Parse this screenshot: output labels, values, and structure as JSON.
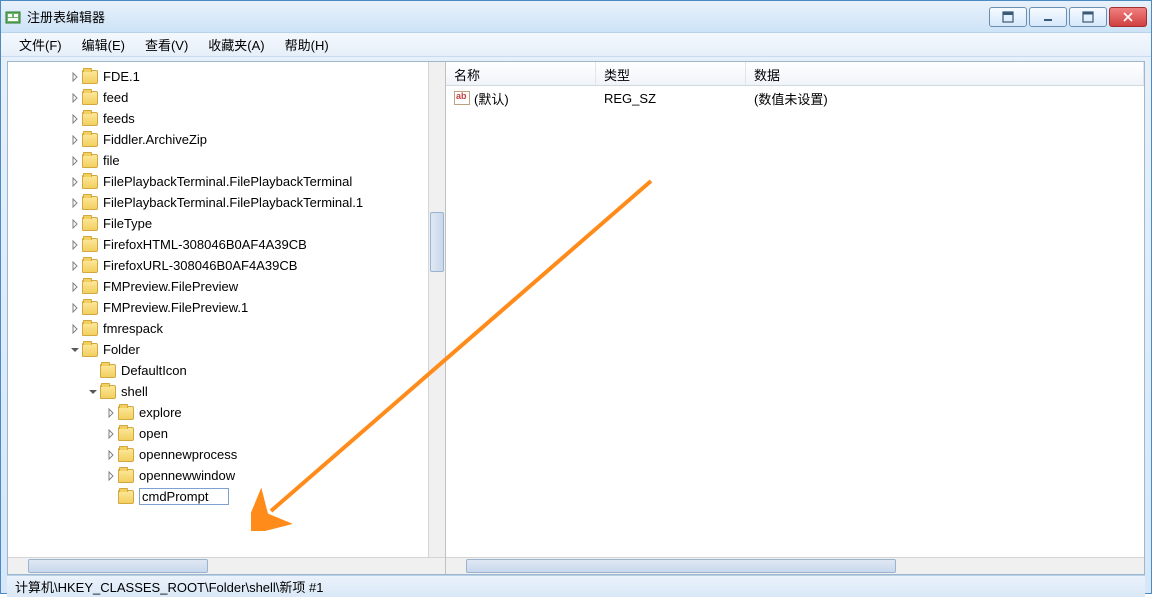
{
  "window": {
    "title": "注册表编辑器"
  },
  "menu": {
    "file": "文件(F)",
    "edit": "编辑(E)",
    "view": "查看(V)",
    "favorites": "收藏夹(A)",
    "help": "帮助(H)"
  },
  "tree": {
    "nodes": [
      {
        "indent": 3,
        "expandable": true,
        "expanded": false,
        "label": "FDE.1"
      },
      {
        "indent": 3,
        "expandable": true,
        "expanded": false,
        "label": "feed"
      },
      {
        "indent": 3,
        "expandable": true,
        "expanded": false,
        "label": "feeds"
      },
      {
        "indent": 3,
        "expandable": true,
        "expanded": false,
        "label": "Fiddler.ArchiveZip"
      },
      {
        "indent": 3,
        "expandable": true,
        "expanded": false,
        "label": "file"
      },
      {
        "indent": 3,
        "expandable": true,
        "expanded": false,
        "label": "FilePlaybackTerminal.FilePlaybackTerminal"
      },
      {
        "indent": 3,
        "expandable": true,
        "expanded": false,
        "label": "FilePlaybackTerminal.FilePlaybackTerminal.1"
      },
      {
        "indent": 3,
        "expandable": true,
        "expanded": false,
        "label": "FileType"
      },
      {
        "indent": 3,
        "expandable": true,
        "expanded": false,
        "label": "FirefoxHTML-308046B0AF4A39CB"
      },
      {
        "indent": 3,
        "expandable": true,
        "expanded": false,
        "label": "FirefoxURL-308046B0AF4A39CB"
      },
      {
        "indent": 3,
        "expandable": true,
        "expanded": false,
        "label": "FMPreview.FilePreview"
      },
      {
        "indent": 3,
        "expandable": true,
        "expanded": false,
        "label": "FMPreview.FilePreview.1"
      },
      {
        "indent": 3,
        "expandable": true,
        "expanded": false,
        "label": "fmrespack"
      },
      {
        "indent": 3,
        "expandable": true,
        "expanded": true,
        "label": "Folder"
      },
      {
        "indent": 4,
        "expandable": false,
        "expanded": false,
        "label": "DefaultIcon"
      },
      {
        "indent": 4,
        "expandable": true,
        "expanded": true,
        "label": "shell"
      },
      {
        "indent": 5,
        "expandable": true,
        "expanded": false,
        "label": "explore"
      },
      {
        "indent": 5,
        "expandable": true,
        "expanded": false,
        "label": "open"
      },
      {
        "indent": 5,
        "expandable": true,
        "expanded": false,
        "label": "opennewprocess"
      },
      {
        "indent": 5,
        "expandable": true,
        "expanded": false,
        "label": "opennewwindow"
      },
      {
        "indent": 5,
        "expandable": false,
        "expanded": false,
        "label": "",
        "editing": true,
        "editValue": "cmdPrompt"
      }
    ]
  },
  "list": {
    "columns": {
      "name": "名称",
      "type": "类型",
      "data": "数据"
    },
    "rows": [
      {
        "name": "(默认)",
        "type": "REG_SZ",
        "data": "(数值未设置)"
      }
    ]
  },
  "statusbar": {
    "path": "计算机\\HKEY_CLASSES_ROOT\\Folder\\shell\\新项 #1"
  }
}
